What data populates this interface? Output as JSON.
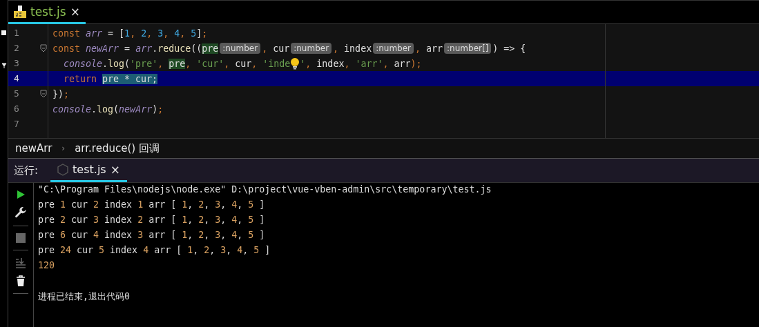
{
  "editor_tab": {
    "label": "test.js",
    "close": "×",
    "selected": true
  },
  "code_lines": [
    {
      "number": "1",
      "current": false,
      "fold": false,
      "tokens": [
        {
          "text": "const ",
          "kind": "kw"
        },
        {
          "text": "arr",
          "kind": "var"
        },
        {
          "text": " = [",
          "kind": "plain"
        },
        {
          "text": "1",
          "kind": "num"
        },
        {
          "text": ", ",
          "kind": "punct"
        },
        {
          "text": "2",
          "kind": "num"
        },
        {
          "text": ", ",
          "kind": "punct"
        },
        {
          "text": "3",
          "kind": "num"
        },
        {
          "text": ", ",
          "kind": "punct"
        },
        {
          "text": "4",
          "kind": "num"
        },
        {
          "text": ", ",
          "kind": "punct"
        },
        {
          "text": "5",
          "kind": "num"
        },
        {
          "text": "]",
          "kind": "plain"
        },
        {
          "text": ";",
          "kind": "punct"
        }
      ]
    },
    {
      "number": "2",
      "current": false,
      "fold": true,
      "tokens": [
        {
          "text": "const ",
          "kind": "kw"
        },
        {
          "text": "newArr",
          "kind": "var"
        },
        {
          "text": " = ",
          "kind": "plain"
        },
        {
          "text": "arr",
          "kind": "var"
        },
        {
          "text": ".",
          "kind": "plain"
        },
        {
          "text": "reduce",
          "kind": "fn"
        },
        {
          "text": "((",
          "kind": "plain"
        },
        {
          "text": "pre",
          "kind": "mark"
        },
        {
          "text": ":number",
          "kind": "hint"
        },
        {
          "text": ", ",
          "kind": "punct"
        },
        {
          "text": "cur",
          "kind": "plain"
        },
        {
          "text": ":number",
          "kind": "hint"
        },
        {
          "text": ", ",
          "kind": "punct"
        },
        {
          "text": "index",
          "kind": "plain"
        },
        {
          "text": ":number",
          "kind": "hint"
        },
        {
          "text": ", ",
          "kind": "punct"
        },
        {
          "text": "arr",
          "kind": "plain"
        },
        {
          "text": ":number[]",
          "kind": "hint"
        },
        {
          "text": ") => {",
          "kind": "plain"
        }
      ]
    },
    {
      "number": "3",
      "current": false,
      "fold": false,
      "indent": true,
      "tokens": [
        {
          "text": "console",
          "kind": "var"
        },
        {
          "text": ".",
          "kind": "plain"
        },
        {
          "text": "log",
          "kind": "fn"
        },
        {
          "text": "(",
          "kind": "plain"
        },
        {
          "text": "'pre'",
          "kind": "str"
        },
        {
          "text": ", ",
          "kind": "punct"
        },
        {
          "text": "pre",
          "kind": "mark"
        },
        {
          "text": ", ",
          "kind": "punct"
        },
        {
          "text": "'cur'",
          "kind": "str"
        },
        {
          "text": ", ",
          "kind": "punct"
        },
        {
          "text": "cur",
          "kind": "plain"
        },
        {
          "text": ", ",
          "kind": "punct"
        },
        {
          "text": "'inde",
          "kind": "str"
        },
        {
          "kind": "bulb"
        },
        {
          "text": "'",
          "kind": "str"
        },
        {
          "text": ", ",
          "kind": "punct"
        },
        {
          "text": "index",
          "kind": "plain"
        },
        {
          "text": ", ",
          "kind": "punct"
        },
        {
          "text": "'arr'",
          "kind": "str"
        },
        {
          "text": ", ",
          "kind": "punct"
        },
        {
          "text": "arr",
          "kind": "plain"
        },
        {
          "text": ");",
          "kind": "punct"
        }
      ]
    },
    {
      "number": "4",
      "current": true,
      "fold": false,
      "indent": true,
      "tokens": [
        {
          "text": "return ",
          "kind": "kw"
        },
        {
          "text": "pre * cur;",
          "kind": "sel"
        }
      ]
    },
    {
      "number": "5",
      "current": false,
      "fold": true,
      "tokens": [
        {
          "text": "})",
          "kind": "plain"
        },
        {
          "text": ";",
          "kind": "punct"
        }
      ]
    },
    {
      "number": "6",
      "current": false,
      "fold": false,
      "tokens": [
        {
          "text": "console",
          "kind": "var"
        },
        {
          "text": ".",
          "kind": "plain"
        },
        {
          "text": "log",
          "kind": "fn"
        },
        {
          "text": "(",
          "kind": "plain"
        },
        {
          "text": "newArr",
          "kind": "var"
        },
        {
          "text": ")",
          "kind": "plain"
        },
        {
          "text": ";",
          "kind": "punct"
        }
      ]
    },
    {
      "number": "7",
      "current": false,
      "fold": false
    }
  ],
  "breadcrumb": {
    "items": [
      "newArr",
      "arr.reduce() 回调"
    ],
    "separator": "›"
  },
  "run_panel": {
    "label": "运行:",
    "tab": {
      "label": "test.js",
      "close": "×",
      "selected": true
    }
  },
  "console_lines": [
    [
      {
        "text": "\"C:\\Program Files\\nodejs\\node.exe\" D:\\project\\vue-vben-admin\\src\\temporary\\test.js",
        "kind": "plain"
      }
    ],
    [
      {
        "text": "pre ",
        "kind": "plain"
      },
      {
        "text": "1",
        "kind": "num"
      },
      {
        "text": " cur ",
        "kind": "plain"
      },
      {
        "text": "2",
        "kind": "num"
      },
      {
        "text": " index ",
        "kind": "plain"
      },
      {
        "text": "1",
        "kind": "num"
      },
      {
        "text": " arr [ ",
        "kind": "plain"
      },
      {
        "text": "1",
        "kind": "num"
      },
      {
        "text": ", ",
        "kind": "plain"
      },
      {
        "text": "2",
        "kind": "num"
      },
      {
        "text": ", ",
        "kind": "plain"
      },
      {
        "text": "3",
        "kind": "num"
      },
      {
        "text": ", ",
        "kind": "plain"
      },
      {
        "text": "4",
        "kind": "num"
      },
      {
        "text": ", ",
        "kind": "plain"
      },
      {
        "text": "5",
        "kind": "num"
      },
      {
        "text": " ]",
        "kind": "plain"
      }
    ],
    [
      {
        "text": "pre ",
        "kind": "plain"
      },
      {
        "text": "2",
        "kind": "num"
      },
      {
        "text": " cur ",
        "kind": "plain"
      },
      {
        "text": "3",
        "kind": "num"
      },
      {
        "text": " index ",
        "kind": "plain"
      },
      {
        "text": "2",
        "kind": "num"
      },
      {
        "text": " arr [ ",
        "kind": "plain"
      },
      {
        "text": "1",
        "kind": "num"
      },
      {
        "text": ", ",
        "kind": "plain"
      },
      {
        "text": "2",
        "kind": "num"
      },
      {
        "text": ", ",
        "kind": "plain"
      },
      {
        "text": "3",
        "kind": "num"
      },
      {
        "text": ", ",
        "kind": "plain"
      },
      {
        "text": "4",
        "kind": "num"
      },
      {
        "text": ", ",
        "kind": "plain"
      },
      {
        "text": "5",
        "kind": "num"
      },
      {
        "text": " ]",
        "kind": "plain"
      }
    ],
    [
      {
        "text": "pre ",
        "kind": "plain"
      },
      {
        "text": "6",
        "kind": "num"
      },
      {
        "text": " cur ",
        "kind": "plain"
      },
      {
        "text": "4",
        "kind": "num"
      },
      {
        "text": " index ",
        "kind": "plain"
      },
      {
        "text": "3",
        "kind": "num"
      },
      {
        "text": " arr [ ",
        "kind": "plain"
      },
      {
        "text": "1",
        "kind": "num"
      },
      {
        "text": ", ",
        "kind": "plain"
      },
      {
        "text": "2",
        "kind": "num"
      },
      {
        "text": ", ",
        "kind": "plain"
      },
      {
        "text": "3",
        "kind": "num"
      },
      {
        "text": ", ",
        "kind": "plain"
      },
      {
        "text": "4",
        "kind": "num"
      },
      {
        "text": ", ",
        "kind": "plain"
      },
      {
        "text": "5",
        "kind": "num"
      },
      {
        "text": " ]",
        "kind": "plain"
      }
    ],
    [
      {
        "text": "pre ",
        "kind": "plain"
      },
      {
        "text": "24",
        "kind": "num"
      },
      {
        "text": " cur ",
        "kind": "plain"
      },
      {
        "text": "5",
        "kind": "num"
      },
      {
        "text": " index ",
        "kind": "plain"
      },
      {
        "text": "4",
        "kind": "num"
      },
      {
        "text": " arr [ ",
        "kind": "plain"
      },
      {
        "text": "1",
        "kind": "num"
      },
      {
        "text": ", ",
        "kind": "plain"
      },
      {
        "text": "2",
        "kind": "num"
      },
      {
        "text": ", ",
        "kind": "plain"
      },
      {
        "text": "3",
        "kind": "num"
      },
      {
        "text": ", ",
        "kind": "plain"
      },
      {
        "text": "4",
        "kind": "num"
      },
      {
        "text": ", ",
        "kind": "plain"
      },
      {
        "text": "5",
        "kind": "num"
      },
      {
        "text": " ]",
        "kind": "plain"
      }
    ],
    [
      {
        "text": "120",
        "kind": "num"
      }
    ],
    [
      {
        "text": "进程已结束,退出代码0",
        "kind": "gap"
      }
    ]
  ],
  "console_tools": [
    {
      "kind": "run",
      "disabled": false
    },
    {
      "kind": "wrench",
      "disabled": false
    },
    {
      "kind": "sep"
    },
    {
      "kind": "stop",
      "disabled": true
    },
    {
      "kind": "sep"
    },
    {
      "kind": "scroll",
      "disabled": true
    },
    {
      "kind": "trash",
      "disabled": false
    },
    {
      "kind": "sep"
    }
  ]
}
